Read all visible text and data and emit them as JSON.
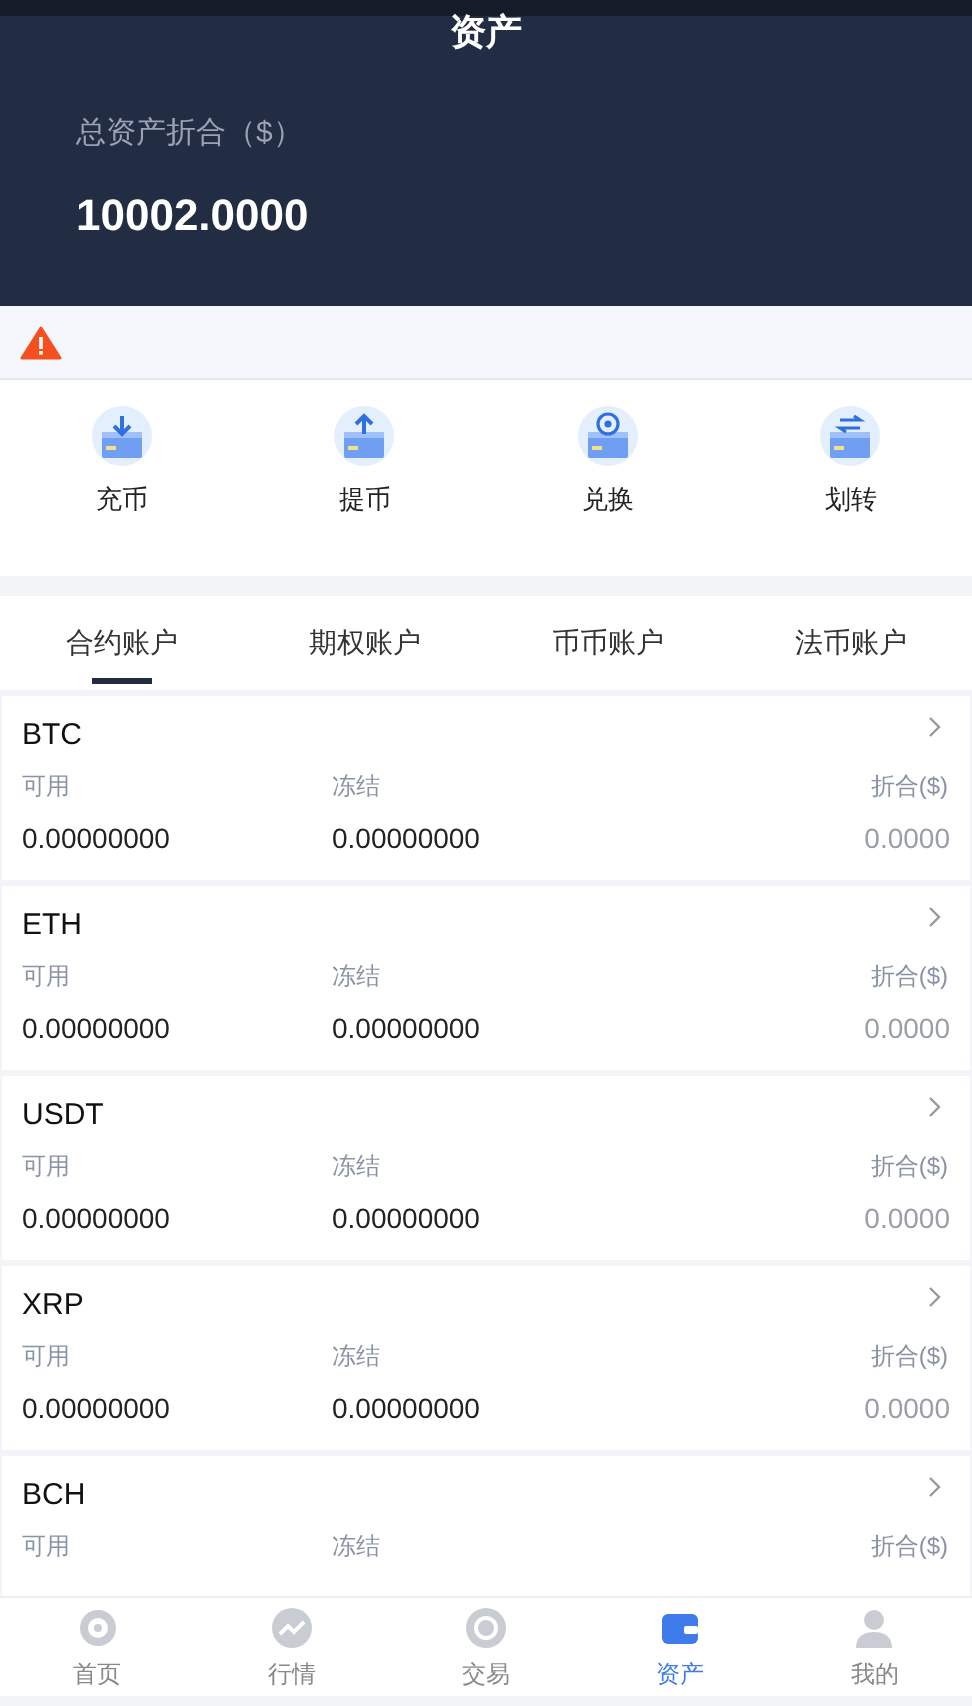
{
  "header": {
    "title": "资产",
    "total_label": "总资产折合（$）",
    "total_value": "10002.0000"
  },
  "actions": [
    {
      "kind": "deposit",
      "label": "充币"
    },
    {
      "kind": "withdraw",
      "label": "提币"
    },
    {
      "kind": "exchange",
      "label": "兑换"
    },
    {
      "kind": "transfer",
      "label": "划转"
    }
  ],
  "tabs": [
    {
      "label": "合约账户",
      "selected": true
    },
    {
      "label": "期权账户",
      "selected": false
    },
    {
      "label": "币币账户",
      "selected": false
    },
    {
      "label": "法币账户",
      "selected": false
    }
  ],
  "accounts": [
    {
      "coin": "BTC",
      "available_label": "可用",
      "frozen_label": "冻结",
      "value_label": "折合($)",
      "available": "0.00000000",
      "frozen": "0.00000000",
      "value": "0.0000"
    },
    {
      "coin": "ETH",
      "available_label": "可用",
      "frozen_label": "冻结",
      "value_label": "折合($)",
      "available": "0.00000000",
      "frozen": "0.00000000",
      "value": "0.0000"
    },
    {
      "coin": "USDT",
      "available_label": "可用",
      "frozen_label": "冻结",
      "value_label": "折合($)",
      "available": "0.00000000",
      "frozen": "0.00000000",
      "value": "0.0000"
    },
    {
      "coin": "XRP",
      "available_label": "可用",
      "frozen_label": "冻结",
      "value_label": "折合($)",
      "available": "0.00000000",
      "frozen": "0.00000000",
      "value": "0.0000"
    },
    {
      "coin": "BCH",
      "available_label": "可用",
      "frozen_label": "冻结",
      "value_label": "折合($)"
    }
  ],
  "nav": [
    {
      "kind": "home",
      "label": "首页",
      "selected": false
    },
    {
      "kind": "market",
      "label": "行情",
      "selected": false
    },
    {
      "kind": "trade",
      "label": "交易",
      "selected": false
    },
    {
      "kind": "assets",
      "label": "资产",
      "selected": true
    },
    {
      "kind": "profile",
      "label": "我的",
      "selected": false
    }
  ]
}
